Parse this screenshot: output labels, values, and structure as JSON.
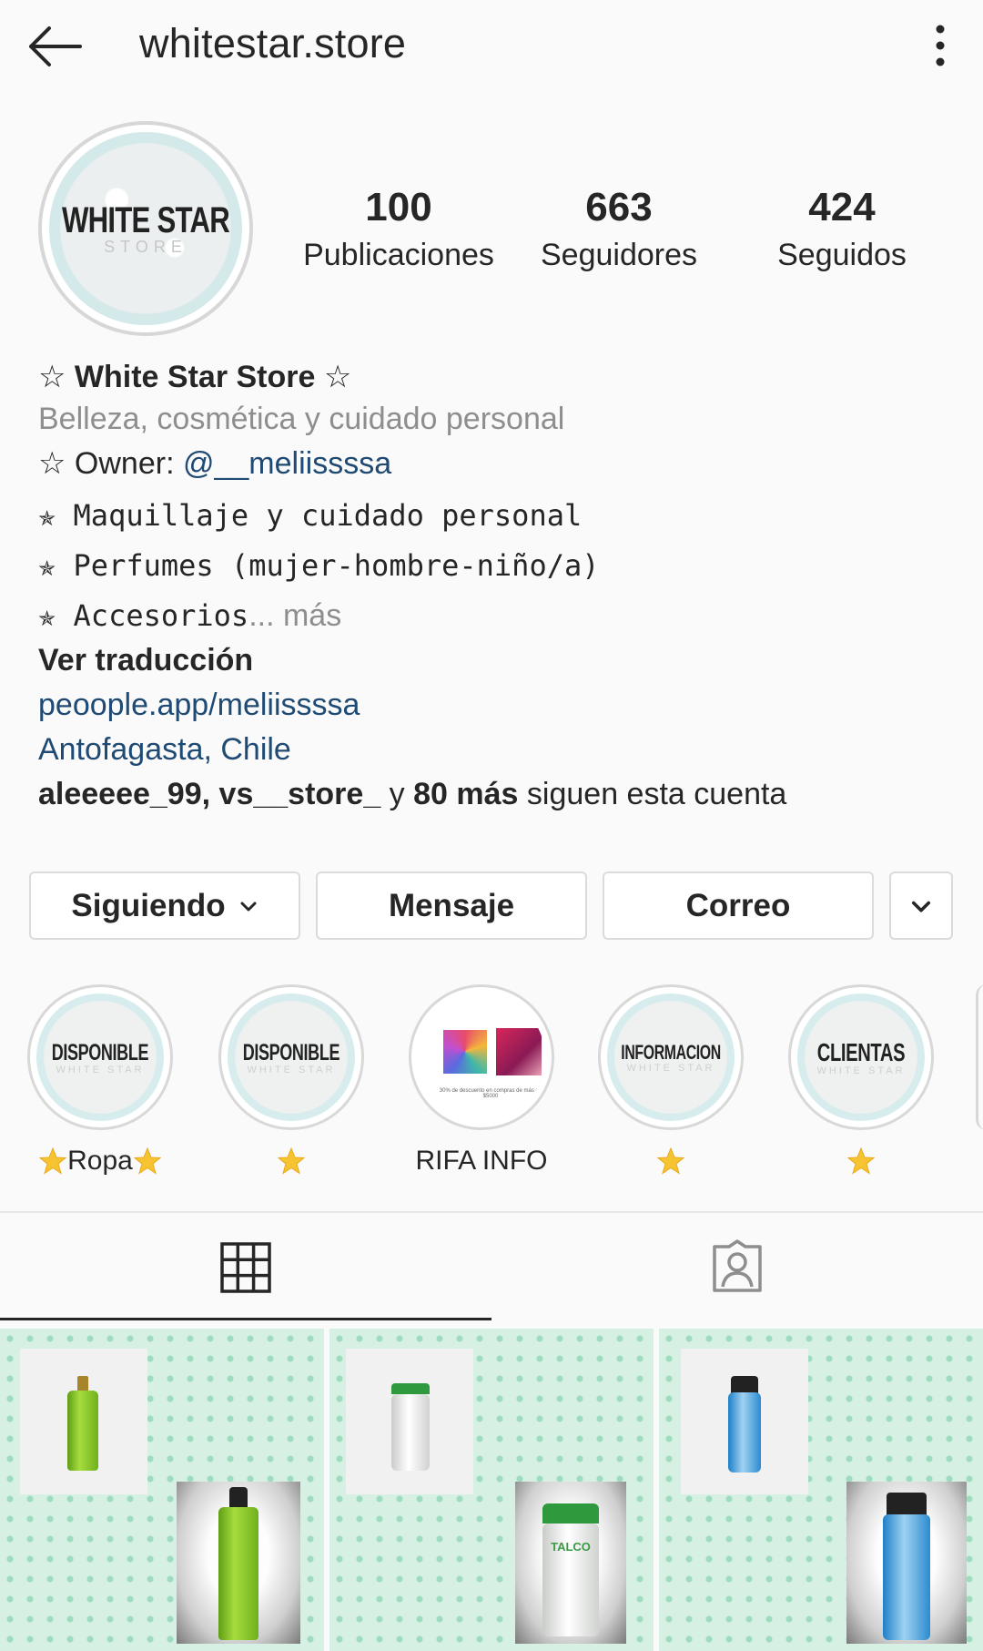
{
  "header": {
    "username": "whitestar.store",
    "back_icon": "arrow-left-icon",
    "more_icon": "more-vertical-icon"
  },
  "profile": {
    "avatar_logo": "WHITE STAR",
    "avatar_subtext": "STORE",
    "stats": {
      "posts_count": "100",
      "posts_label": "Publicaciones",
      "followers_count": "663",
      "followers_label": "Seguidores",
      "following_count": "424",
      "following_label": "Seguidos"
    }
  },
  "bio": {
    "name": "☆ White Star Store ☆",
    "category": "Belleza, cosmética y cuidado personal",
    "owner_prefix": "☆ Owner: ",
    "owner_mention": "@__meliissssa",
    "line1": "✯ Maquillaje y cuidado personal",
    "line2": "✯ Perfumes (mujer-hombre-niño/a)",
    "line3": "✯ Accesorios",
    "ellipsis": "... ",
    "more": "más",
    "translate": "Ver traducción",
    "link": "peoople.app/meliissssa",
    "location": "Antofagasta, Chile",
    "followed_by_user1": "aleeeee_99",
    "followed_by_sep": ", ",
    "followed_by_user2": "vs__store_",
    "followed_by_y": " y ",
    "followed_by_more": "80 más",
    "followed_by_suffix": " siguen esta cuenta"
  },
  "buttons": {
    "following": "Siguiendo",
    "message": "Mensaje",
    "email": "Correo"
  },
  "highlights": [
    {
      "cover_text": "DISPONIBLE",
      "cover_sub": "WHITE STAR",
      "label": "Ropa"
    },
    {
      "cover_text": "DISPONIBLE",
      "cover_sub": "WHITE STAR",
      "label": ""
    },
    {
      "cover_caption": "30% de descuento en compras de más de $5000",
      "label": "RIFA INFO"
    },
    {
      "cover_text": "INFORMACION",
      "cover_sub": "WHITE STAR",
      "label": ""
    },
    {
      "cover_text": "CLIENTAS",
      "cover_sub": "WHITE STAR",
      "label": ""
    }
  ],
  "tabs": {
    "grid_icon": "grid-icon",
    "tagged_icon": "tagged-person-icon",
    "active": "grid"
  },
  "posts": [
    {
      "subject": "green-spray-bottle",
      "bottle_label": ""
    },
    {
      "subject": "white-powder-bottle",
      "bottle_label": "TALCO"
    },
    {
      "subject": "blue-shampoo-bottle",
      "bottle_label": ""
    }
  ],
  "colors": {
    "link": "#1f4a73",
    "secondary_text": "#8e8e8e",
    "post_background": "#d6f1e4",
    "star": "#f6c431"
  }
}
